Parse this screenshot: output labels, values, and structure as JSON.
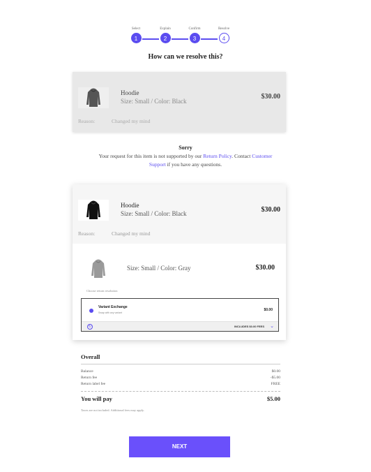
{
  "stepper": {
    "steps": [
      {
        "label": "Select",
        "number": "1"
      },
      {
        "label": "Explain",
        "number": "2"
      },
      {
        "label": "Confirm",
        "number": "3"
      },
      {
        "label": "Resolve",
        "number": "4"
      }
    ]
  },
  "heading": "How can we resolve this?",
  "disabled_item": {
    "name": "Hoodie",
    "variant": "Size: Small / Color: Black",
    "price": "$30.00",
    "reason_label": "Reason:",
    "reason_value": "Changed my mind"
  },
  "sorry": {
    "title": "Sorry",
    "text_before": "Your request for this item is not supported by our ",
    "policy_link": "Return Policy",
    "text_middle": ". Contact ",
    "support_link": "Customer Support",
    "text_after": " if you have any questions."
  },
  "active_item": {
    "name": "Hoodie",
    "variant": "Size: Small / Color: Black",
    "price": "$30.00",
    "reason_label": "Reason:",
    "reason_value": "Changed my mind"
  },
  "exchange": {
    "variant": "Size: Small / Color: Gray",
    "price": "$30.00",
    "choose_label": "Choose return resolution",
    "option": {
      "title": "Variant Exchange",
      "subtitle": "Swap with any variant",
      "price": "$0.00",
      "fees_label": "INCLUDES $0.00 FEES"
    }
  },
  "overall": {
    "title": "Overall",
    "rows": [
      {
        "label": "Balance",
        "value": "$0.00"
      },
      {
        "label": "Return fee",
        "value": "-$5.00"
      },
      {
        "label": "Return label fee",
        "value": "FREE"
      }
    ],
    "pay_label": "You will pay",
    "pay_value": "$5.00",
    "note": "Taxes are not included. Additional fees may apply."
  },
  "next_label": "NEXT",
  "colors": {
    "accent": "#5b4cf0",
    "button": "#6a50fb"
  }
}
